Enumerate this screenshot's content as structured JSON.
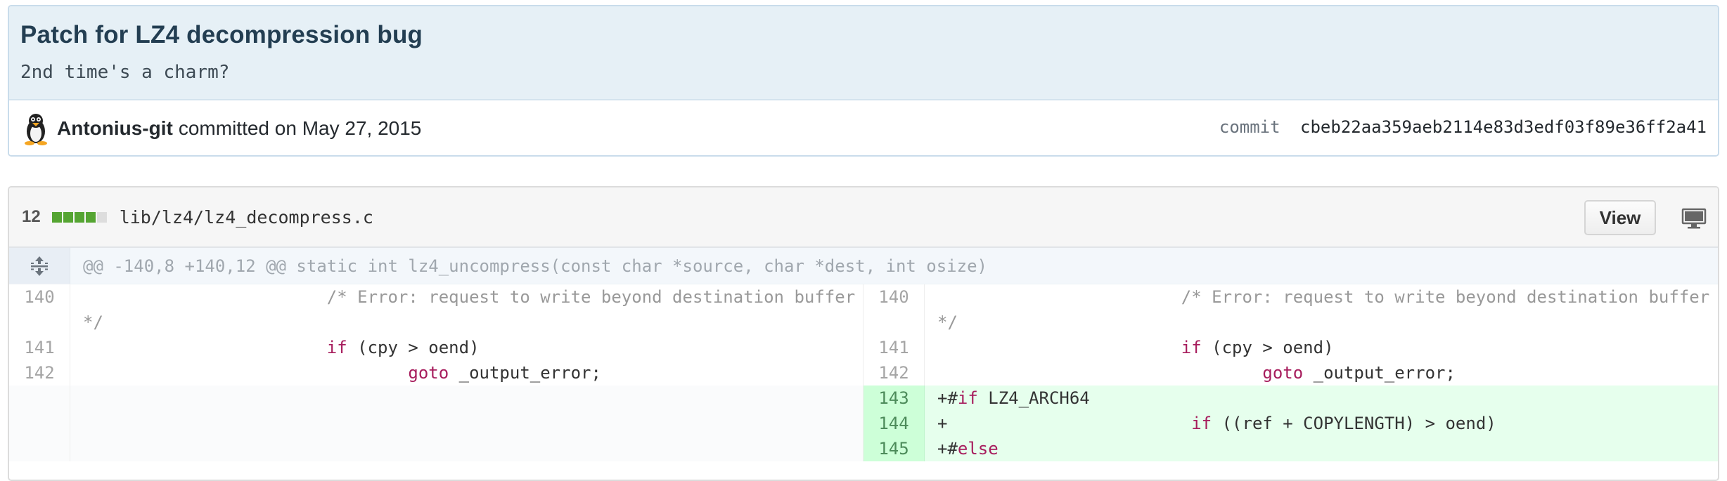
{
  "commit": {
    "title": "Patch for LZ4 decompression bug",
    "description": "2nd time's a charm?",
    "author": "Antonius-git",
    "committed_text": "committed on May 27, 2015",
    "sha_label": "commit",
    "sha": "cbeb22aa359aeb2114e83d3edf03f89e36ff2a41"
  },
  "file": {
    "change_count": "12",
    "path": "lib/lz4/lz4_decompress.c",
    "view_label": "View",
    "diffstat": [
      "added",
      "added",
      "added",
      "added",
      "neutral"
    ],
    "hunk_header": "@@ -140,8 +140,12 @@ static int lz4_uncompress(const char *source, char *dest, int osize)"
  },
  "colors": {
    "added": "#55a532",
    "neutral": "#dddddd",
    "keyword": "#a71d5d",
    "comment": "#999999"
  },
  "icons": {
    "avatar": "penguin-avatar",
    "expand": "unfold-icon",
    "display": "desktop-icon"
  },
  "left_lines": [
    {
      "num": "140",
      "indent": "\t\t\t",
      "comment": "/* Error: request to write beyond destination buffer */"
    },
    {
      "num": "141",
      "indent": "\t\t\t",
      "kw": "if",
      "rest": " (cpy > oend)"
    },
    {
      "num": "142",
      "indent": "\t\t\t\t",
      "kw": "goto",
      "rest": " _output_error;"
    }
  ],
  "right_lines": [
    {
      "num": "140",
      "indent": "\t\t\t",
      "comment": "/* Error: request to write beyond destination buffer */"
    },
    {
      "num": "141",
      "indent": "\t\t\t",
      "kw": "if",
      "rest": " (cpy > oend)"
    },
    {
      "num": "142",
      "indent": "\t\t\t\t",
      "kw": "goto",
      "rest": " _output_error;"
    },
    {
      "num": "143",
      "prefix": "+#",
      "kw": "if",
      "rest": " LZ4_ARCH64"
    },
    {
      "num": "144",
      "prefix": "+\t\t\t",
      "kw": "if",
      "rest": " ((ref + COPYLENGTH) > oend)"
    },
    {
      "num": "145",
      "prefix": "+#",
      "kw": "else",
      "rest": ""
    }
  ]
}
